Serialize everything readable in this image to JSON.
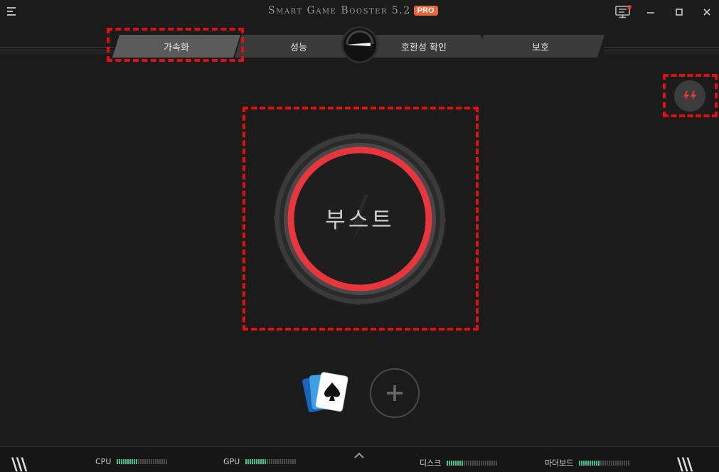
{
  "app": {
    "title": "Smart Game Booster 5.2",
    "badge": "PRO"
  },
  "tabs": [
    {
      "label": "가속화",
      "active": true
    },
    {
      "label": "성능",
      "active": false
    },
    {
      "label": "호환성 확인",
      "active": false
    },
    {
      "label": "보호",
      "active": false
    }
  ],
  "boost": {
    "label": "부스트",
    "ring_color": "#e8363c"
  },
  "footer": {
    "stats": [
      {
        "label": "CPU",
        "level": 0.4
      },
      {
        "label": "GPU",
        "level": 0.4
      },
      {
        "label": "디스크",
        "level": 0.35
      },
      {
        "label": "마더보드",
        "level": 0.4
      }
    ]
  },
  "icons": {
    "menu": "menu-icon",
    "notify": "monitor-notification-icon",
    "turbo": "turbo-boost-icon",
    "game": "solitaire-cards-icon",
    "add": "plus-icon",
    "expand": "chevron-up-icon"
  },
  "colors": {
    "accent": "#e8363c",
    "badge": "#e8663a",
    "meter": "#3fbf8a"
  }
}
